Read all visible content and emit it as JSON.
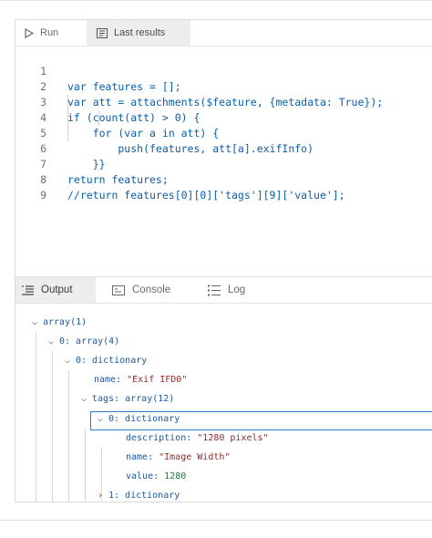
{
  "editor": {
    "tabs": {
      "run": "Run",
      "last_results": "Last results"
    },
    "line_numbers": [
      "1",
      "2",
      "3",
      "4",
      "5",
      "6",
      "7",
      "8",
      "9"
    ],
    "lines": [
      "var features = [];",
      "var att = attachments($feature, {metadata: True});",
      "if (count(att) > 0) {",
      "    for (var a in att) {",
      "        push(features, att[a].exifInfo)",
      "    }}",
      "return features;",
      "//return features[0][0]['tags'][9]['value'];",
      ""
    ]
  },
  "output": {
    "tabs": {
      "output": "Output",
      "console": "Console",
      "log": "Log"
    },
    "tree": {
      "root": "array(1)",
      "item0": "0: array(4)",
      "item0_0": "0: dictionary",
      "name_key": "name: ",
      "name_val": "\"Exif IFD0\"",
      "tags": "tags: array(12)",
      "tag0": "0: dictionary",
      "desc_key": "description: ",
      "desc_val": "\"1280 pixels\"",
      "tname_key": "name: ",
      "tname_val": "\"Image Width\"",
      "value_key": "value: ",
      "value_val": "1280",
      "tag1": "1: dictionary"
    }
  },
  "colors": {
    "code_text": "#0b5ea8",
    "selection_border": "#2c7ad0",
    "active_tab_bg": "#ededed"
  }
}
